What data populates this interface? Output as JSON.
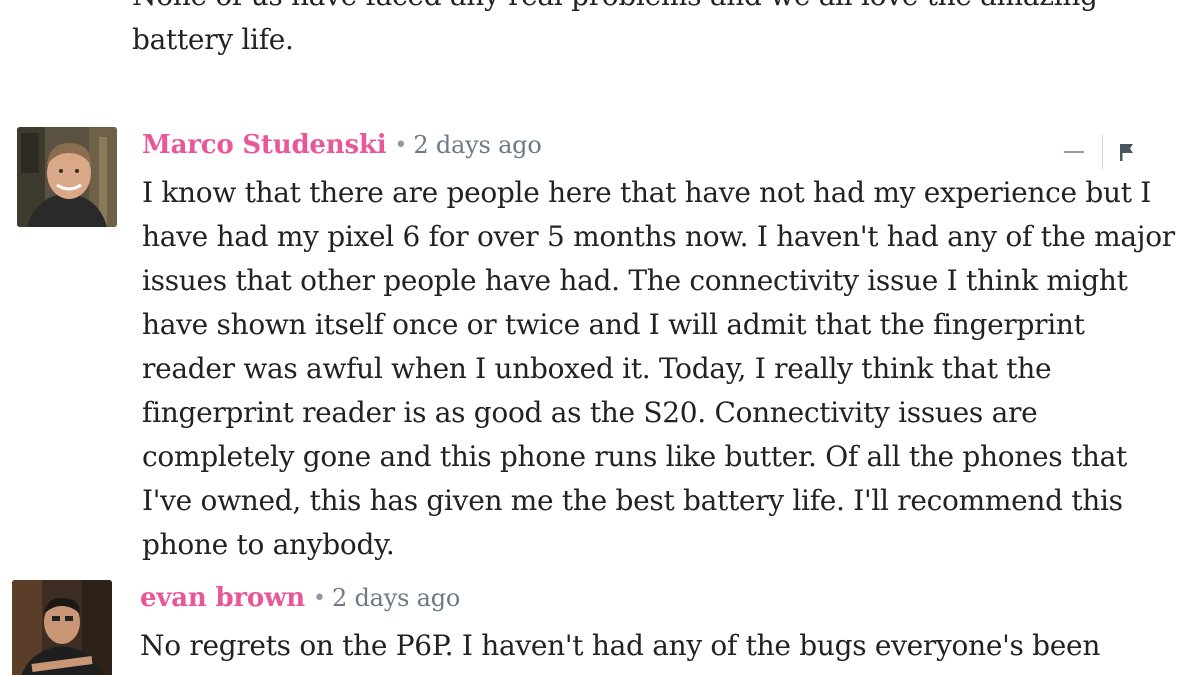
{
  "previous_comment": {
    "text": "None of us have faced any real problems and we all love the amazing battery life."
  },
  "comments": [
    {
      "author": "Marco Studenski",
      "separator": "•",
      "timestamp": "2 days ago",
      "text": "I know that there are people here that have not had my experience but I have had my pixel 6 for over 5 months now. I haven't had any of the major issues that other people have had. The connectivity issue I think might have shown itself once or twice and I will admit that the fingerprint reader was awful when I unboxed it. Today, I really think that the fingerprint reader is as good as the S20. Connectivity issues are completely gone and this phone runs like butter. Of all the phones that I've owned, this has given me the best battery life. I'll recommend this phone to anybody."
    },
    {
      "author": "evan brown",
      "separator": "•",
      "timestamp": "2 days ago",
      "text": "No regrets on the P6P. I haven't had any of the bugs everyone's been"
    }
  ],
  "controls": {
    "collapse_icon": "minus-icon",
    "flag_icon": "flag-icon"
  },
  "colors": {
    "author": "#e8579a",
    "timestamp": "#6d7a85",
    "text": "#222222",
    "icons": "#8f9aa4"
  }
}
